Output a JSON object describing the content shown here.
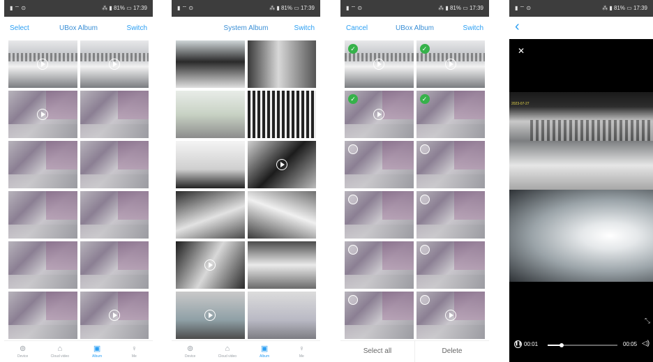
{
  "status": {
    "left": "▮ ⌔ ⊙",
    "right": "⁂ ▮ 81% ▭ 17:39"
  },
  "screen1": {
    "left": "Select",
    "title": "UBox Album",
    "right": "Switch",
    "tabs": [
      {
        "label": "Device",
        "icon": "⊚"
      },
      {
        "label": "Cloud video",
        "icon": "⌂"
      },
      {
        "label": "Album",
        "icon": "▣"
      },
      {
        "label": "Me",
        "icon": "♀"
      }
    ]
  },
  "screen2": {
    "title": "System Album",
    "right": "Switch",
    "tabs": [
      {
        "label": "Device",
        "icon": "⊚"
      },
      {
        "label": "Cloud video",
        "icon": "⌂"
      },
      {
        "label": "Album",
        "icon": "▣"
      },
      {
        "label": "Me",
        "icon": "♀"
      }
    ]
  },
  "screen3": {
    "left": "Cancel",
    "title": "UBox Album",
    "right": "Switch",
    "select_all": "Select all",
    "delete": "Delete",
    "check_mark": "✓"
  },
  "screen4": {
    "back": "‹",
    "close": "✕",
    "osd": "2023-07-27",
    "current_time": "00:01",
    "total_time": "00:05",
    "play_icon": "❚❚",
    "volume_icon": "◁)",
    "fullscreen_icon": "⤡",
    "progress_fraction": 0.2
  },
  "colors": {
    "accent": "#2b9ff3",
    "check": "#36b24a"
  }
}
